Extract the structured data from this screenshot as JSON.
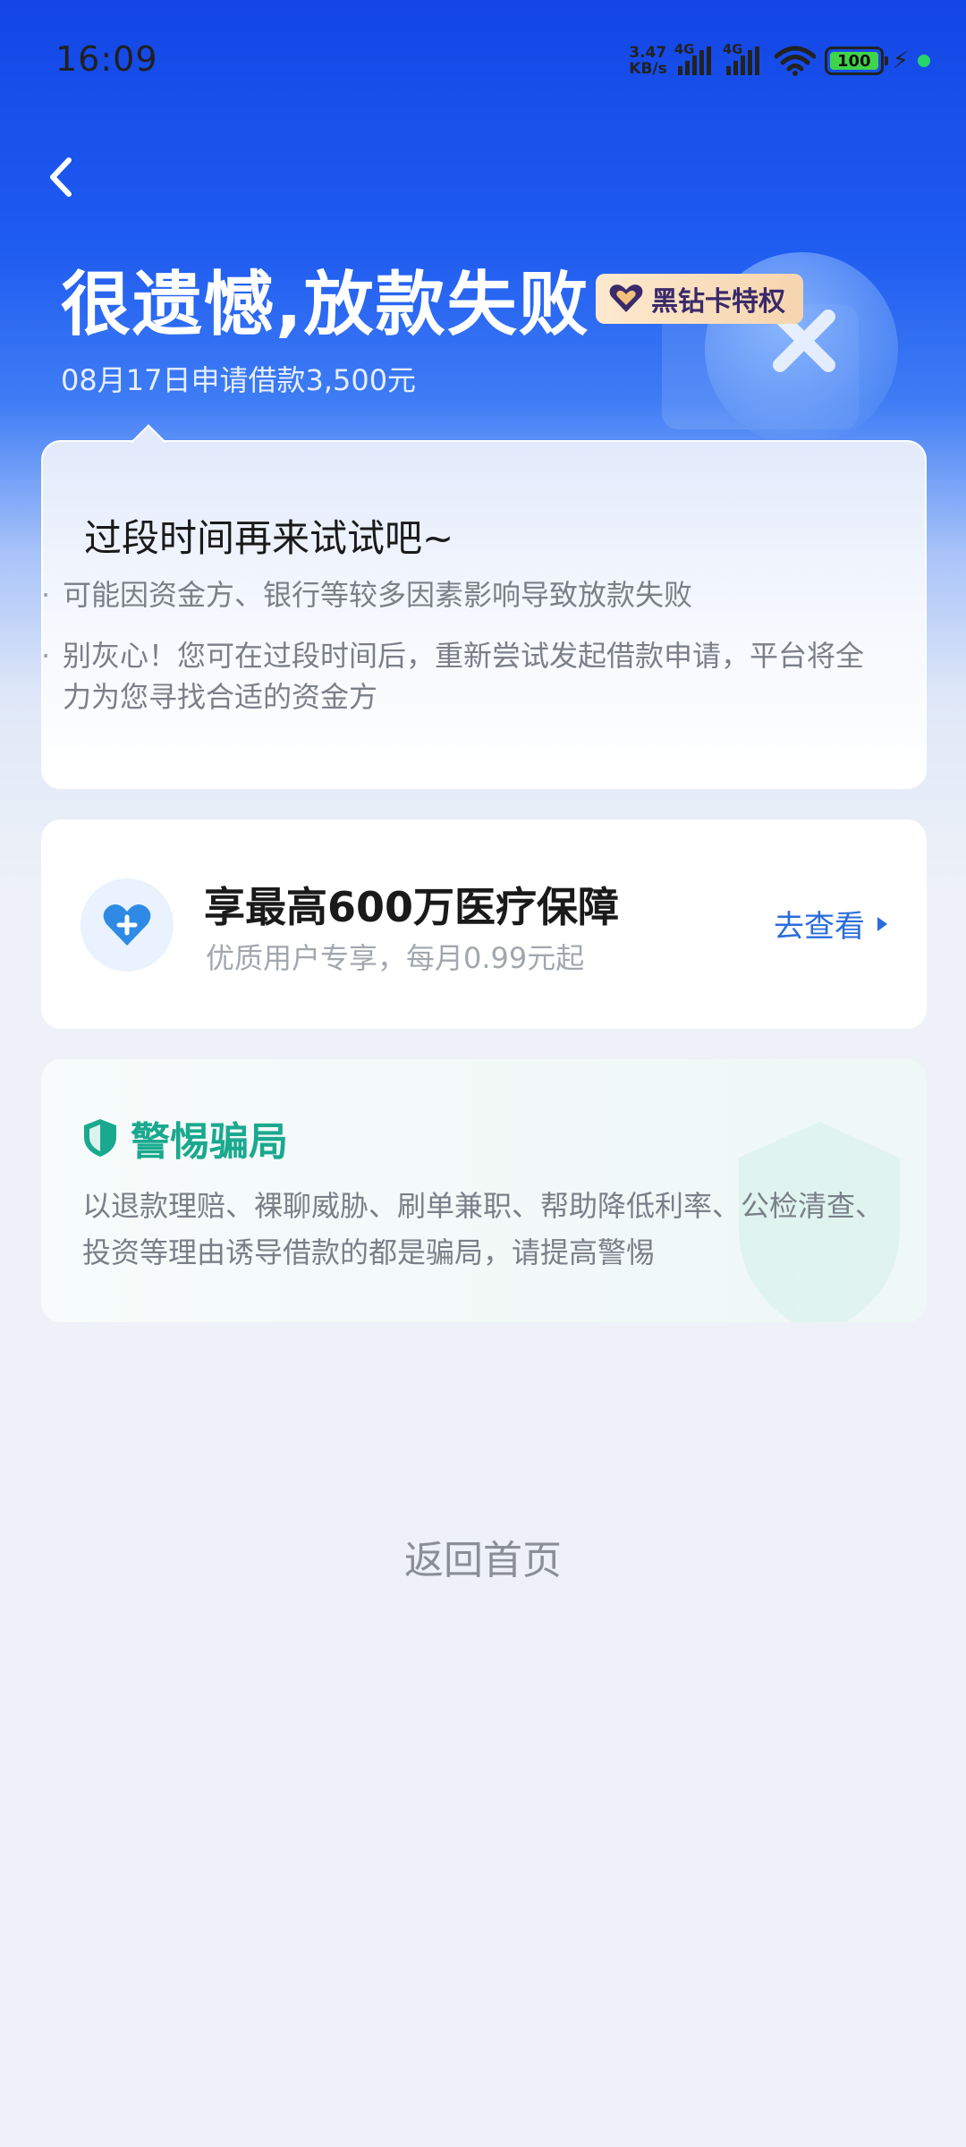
{
  "status_bar": {
    "time": "16:09",
    "net_speed_value": "3.47",
    "net_speed_unit": "KB/s",
    "sim1_label": "4G",
    "sim2_label": "4G",
    "battery": "100"
  },
  "header": {
    "title": "很遗憾,放款失败",
    "badge": "黑钻卡特权",
    "subtitle": "08月17日申请借款3,500元"
  },
  "tips_card": {
    "heading": "过段时间再来试试吧~",
    "bullets": [
      "可能因资金方、银行等较多因素影响导致放款失败",
      "别灰心！您可在过段时间后，重新尝试发起借款申请，平台将全力为您寻找合适的资金方"
    ]
  },
  "insurance_card": {
    "title": "享最高600万医疗保障",
    "subtitle": "优质用户专享，每月0.99元起",
    "action": "去查看"
  },
  "warning_card": {
    "title": "警惕骗局",
    "text": "以退款理赔、裸聊威胁、刷单兼职、帮助降低利率、公检清查、投资等理由诱导借款的都是骗局，请提高警惕"
  },
  "footer": {
    "home_link": "返回首页"
  },
  "colors": {
    "hero_blue": "#1346e6",
    "accent_blue": "#2a6cdc",
    "warning_green": "#1aa98e",
    "page_bg": "#eef2f8"
  }
}
